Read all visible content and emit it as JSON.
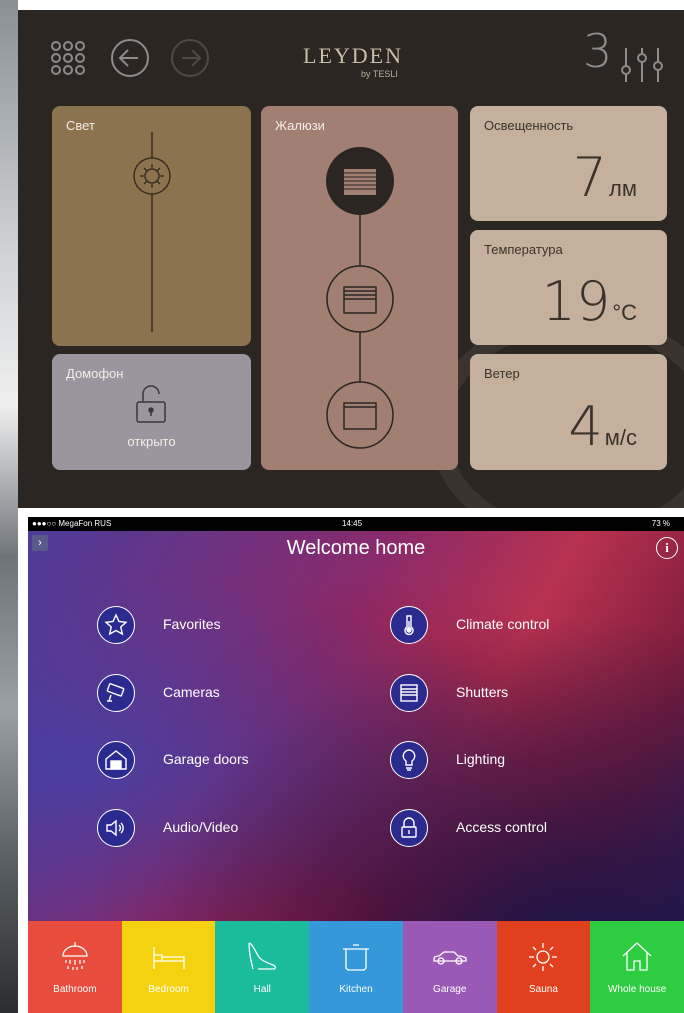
{
  "colors": {
    "leyden_bg": "#2b2622",
    "light_card": "#8b7350",
    "intercom_card": "#9a96a0",
    "blinds_card": "#a17f73",
    "sensor_card": "#c4b09c",
    "rooms": [
      "#e74c3c",
      "#f5d20f",
      "#1abc9c",
      "#3498db",
      "#9b59b6",
      "#e1401f",
      "#2ecc40"
    ]
  },
  "leyden": {
    "logo": "LEYDEN",
    "logo_sub": "by TESLI",
    "page_number": "3",
    "nav_icons": [
      "grid-icon",
      "back-arrow-icon",
      "forward-arrow-icon",
      "sliders-icon"
    ],
    "light": {
      "label": "Свет"
    },
    "intercom": {
      "label": "Домофон",
      "status": "открыто"
    },
    "blinds": {
      "label": "Жалюзи"
    },
    "illumination": {
      "label": "Освещенность",
      "value": "7",
      "unit": "лм"
    },
    "temperature": {
      "label": "Температура",
      "value": "19",
      "unit": "°С"
    },
    "wind": {
      "label": "Ветер",
      "value": "4",
      "unit": "м/с"
    }
  },
  "app": {
    "status": {
      "carrier": "●●●○○ MegaFon RUS",
      "time": "14:45",
      "battery": "73 %"
    },
    "title": "Welcome home",
    "menu_left": [
      {
        "label": "Favorites",
        "icon": "star-icon"
      },
      {
        "label": "Cameras",
        "icon": "camera-icon"
      },
      {
        "label": "Garage doors",
        "icon": "garage-icon"
      },
      {
        "label": "Audio/Video",
        "icon": "speaker-icon"
      }
    ],
    "menu_right": [
      {
        "label": "Climate control",
        "icon": "thermometer-icon"
      },
      {
        "label": "Shutters",
        "icon": "shutters-icon"
      },
      {
        "label": "Lighting",
        "icon": "bulb-icon"
      },
      {
        "label": "Access control",
        "icon": "lock-icon"
      }
    ],
    "rooms": [
      {
        "label": "Bathroom",
        "icon": "shower-icon"
      },
      {
        "label": "Bedroom",
        "icon": "bed-icon"
      },
      {
        "label": "Hall",
        "icon": "shoe-icon"
      },
      {
        "label": "Kitchen",
        "icon": "pot-icon"
      },
      {
        "label": "Garage",
        "icon": "car-icon"
      },
      {
        "label": "Sauna",
        "icon": "sun-icon"
      },
      {
        "label": "Whole house",
        "icon": "house-icon"
      }
    ]
  }
}
